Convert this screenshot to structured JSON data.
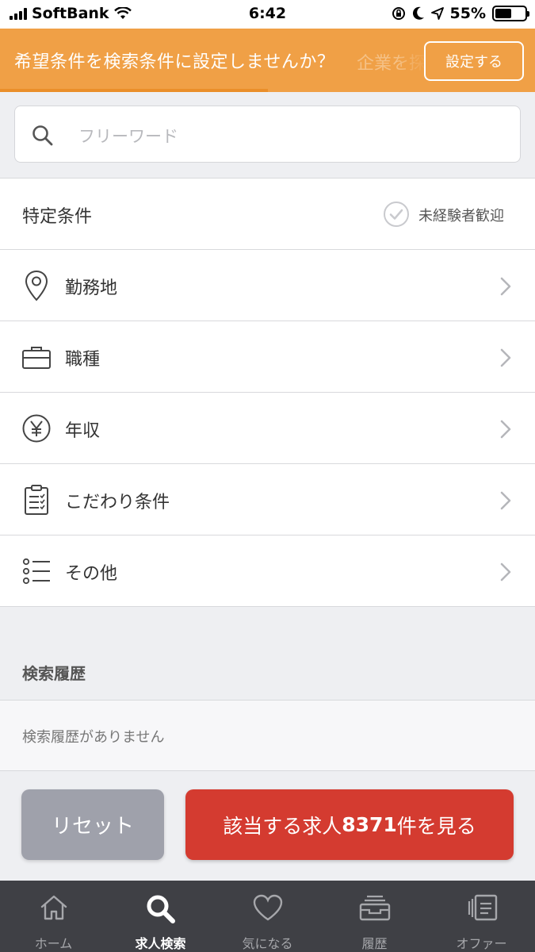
{
  "status_bar": {
    "carrier": "SoftBank",
    "time": "6:42",
    "battery": "55%",
    "battery_level": 0.55
  },
  "banner": {
    "message": "希望条件を検索条件に設定しませんか？",
    "trailing_text": "企業を探",
    "button_label": "設定する"
  },
  "search": {
    "placeholder": "フリーワード"
  },
  "conditions": {
    "special_label": "特定条件",
    "special_chip": "未経験者歓迎",
    "items": [
      {
        "label": "勤務地",
        "icon": "location-pin-icon"
      },
      {
        "label": "職種",
        "icon": "briefcase-icon"
      },
      {
        "label": "年収",
        "icon": "yen-icon"
      },
      {
        "label": "こだわり条件",
        "icon": "clipboard-icon"
      },
      {
        "label": "その他",
        "icon": "list-icon"
      }
    ]
  },
  "history": {
    "heading": "検索履歴",
    "empty_text": "検索履歴がありません"
  },
  "actions": {
    "reset_label": "リセット",
    "search_prefix": "該当する求人",
    "search_count": "8371",
    "search_suffix": "件を見る"
  },
  "tabbar": {
    "tabs": [
      {
        "label": "ホーム",
        "icon": "home-icon"
      },
      {
        "label": "求人検索",
        "icon": "search-icon",
        "active": true
      },
      {
        "label": "気になる",
        "icon": "heart-icon"
      },
      {
        "label": "履歴",
        "icon": "inbox-icon"
      },
      {
        "label": "オファー",
        "icon": "offer-cards-icon"
      }
    ]
  },
  "colors": {
    "banner": "#f0a046",
    "primary_button": "#d43b30",
    "reset_button": "#9fa1ab",
    "tabbar": "#3f4045"
  }
}
